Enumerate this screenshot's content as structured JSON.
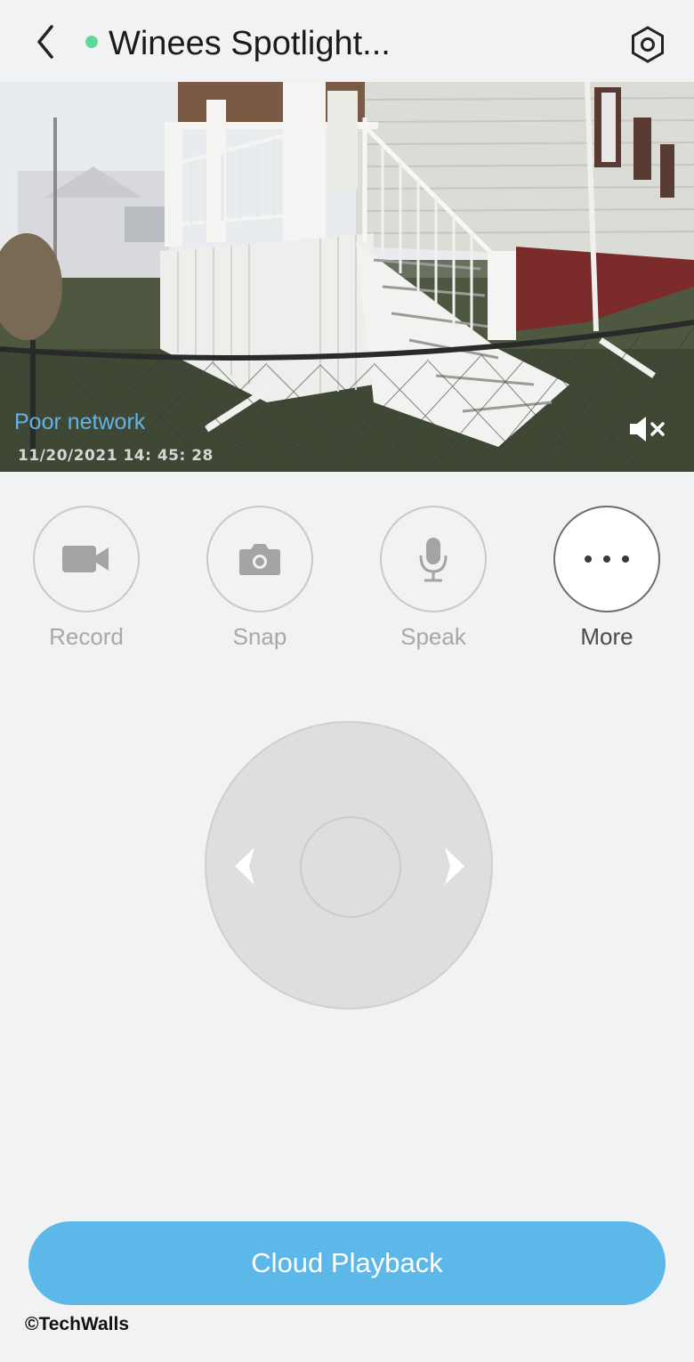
{
  "header": {
    "title": "Winees Spotlight...",
    "online_color": "#5fd89a"
  },
  "video": {
    "network_status": "Poor network",
    "timestamp": "11/20/2021  14: 45: 28",
    "audio": "muted"
  },
  "actions": [
    {
      "label": "Record",
      "icon": "video-camera-icon"
    },
    {
      "label": "Snap",
      "icon": "camera-icon"
    },
    {
      "label": "Speak",
      "icon": "microphone-icon"
    },
    {
      "label": "More",
      "icon": "more-dots-icon"
    }
  ],
  "ptz": {
    "left_icon": "chevron-left-icon",
    "right_icon": "chevron-right-icon"
  },
  "cloud_button": {
    "label": "Cloud Playback",
    "color": "#5db8ea"
  },
  "watermark": "©TechWalls"
}
